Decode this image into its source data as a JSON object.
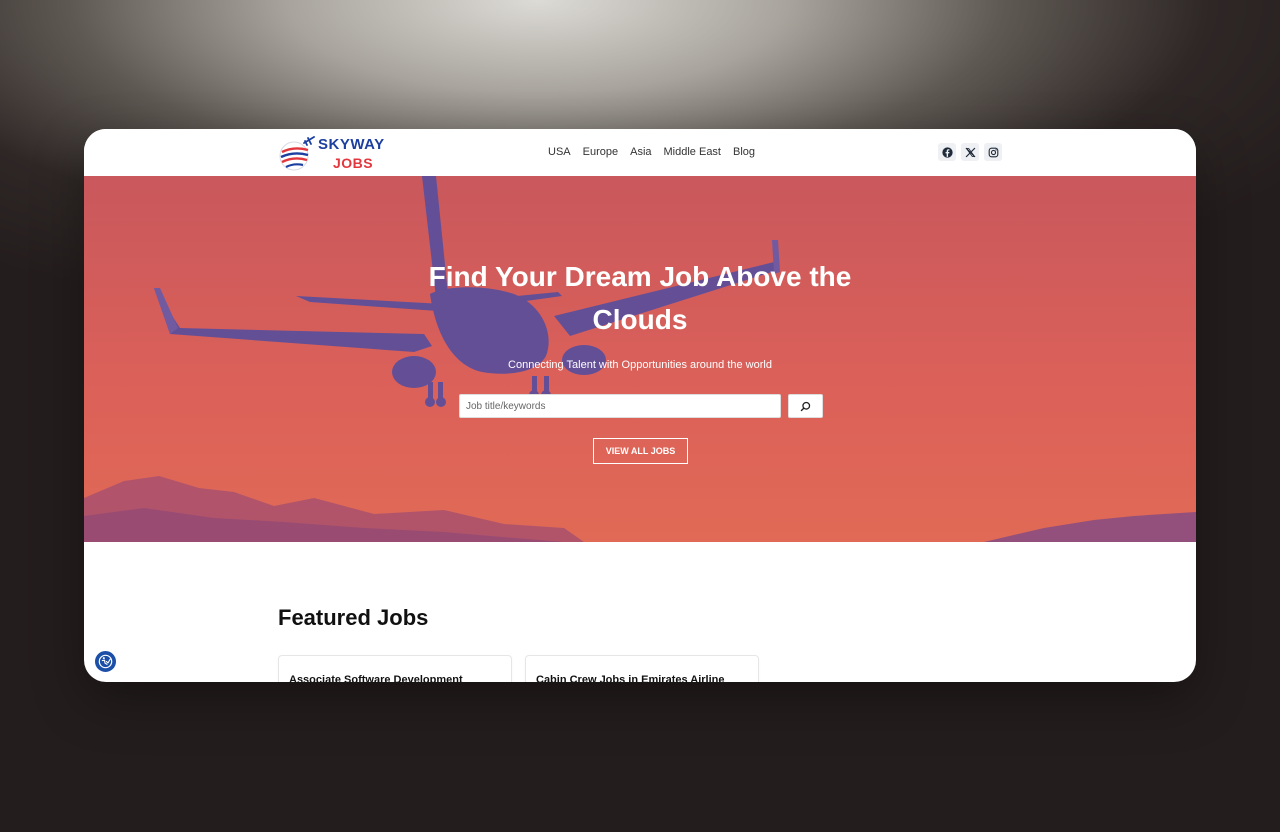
{
  "header": {
    "logo_top": "SKYWAY",
    "logo_bottom": "JOBS",
    "nav": [
      "USA",
      "Europe",
      "Asia",
      "Middle East",
      "Blog"
    ],
    "socials": [
      "facebook-icon",
      "x-icon",
      "instagram-icon"
    ]
  },
  "hero": {
    "title": "Find Your Dream Job Above the Clouds",
    "subtitle": "Connecting Talent with Opportunities around the world",
    "search_placeholder": "Job title/keywords",
    "search_value": "",
    "search_button_icon": "search-icon",
    "view_all_label": "VIEW ALL JOBS"
  },
  "featured": {
    "heading": "Featured Jobs",
    "jobs": [
      {
        "title": "Associate Software Development"
      },
      {
        "title": "Cabin Crew Jobs in Emirates Airline"
      }
    ]
  },
  "accessibility": {
    "icon": "accessibility-icon"
  },
  "colors": {
    "brand_blue": "#1d3f9f",
    "brand_red": "#e2383d",
    "hero_bg": "#d9605a",
    "plane": "#5a4e9c",
    "accessibility_blue": "#1b4fa8"
  }
}
